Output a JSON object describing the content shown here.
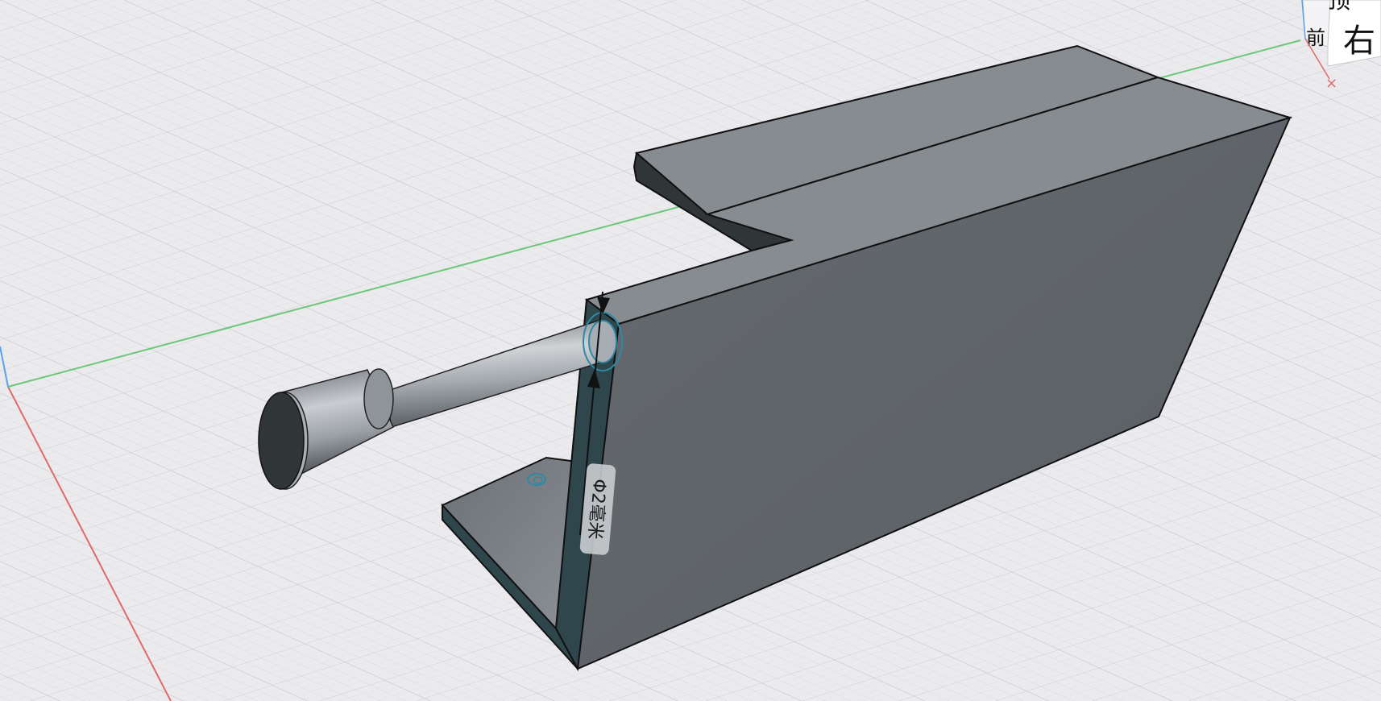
{
  "viewport": {
    "background": "#ebebee",
    "grid_minor_color": "#d7d7dc",
    "grid_major_color": "#c9c9cf",
    "axis_colors": {
      "x": "#e06a6a",
      "y": "#6cc77a",
      "z": "#5aa0ee"
    }
  },
  "model": {
    "face_top_color": "#878c91",
    "face_side_color": "#5f6469",
    "face_dark_color": "#303538",
    "selected_color": "#2e464c",
    "highlight_color": "#2c8aa6"
  },
  "dimension": {
    "label": "Φ2毫米"
  },
  "view_cube": {
    "top_label": "顶",
    "right_label": "右",
    "front_label": "前",
    "axis_x_label": "×"
  }
}
